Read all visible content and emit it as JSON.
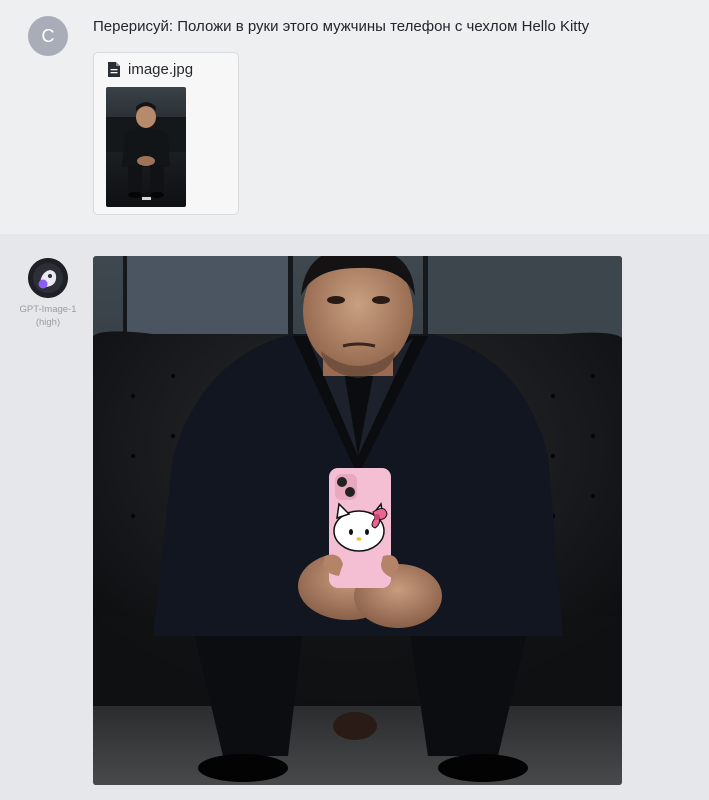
{
  "user_message": {
    "avatar_letter": "C",
    "text": "Перерисуй: Положи в руки этого мужчины телефон с чехлом Hello Kitty",
    "attachment": {
      "icon": "file-icon",
      "file_name": "image.jpg"
    }
  },
  "assistant_message": {
    "avatar_icon": "bot-avatar-icon",
    "model_name": "GPT-Image-1",
    "model_quality": "(high)"
  },
  "colors": {
    "user_bg": "#eeeff1",
    "assistant_bg": "#e6e7ea",
    "phone_case": "#f4bfd2",
    "bow": "#e8668f"
  }
}
